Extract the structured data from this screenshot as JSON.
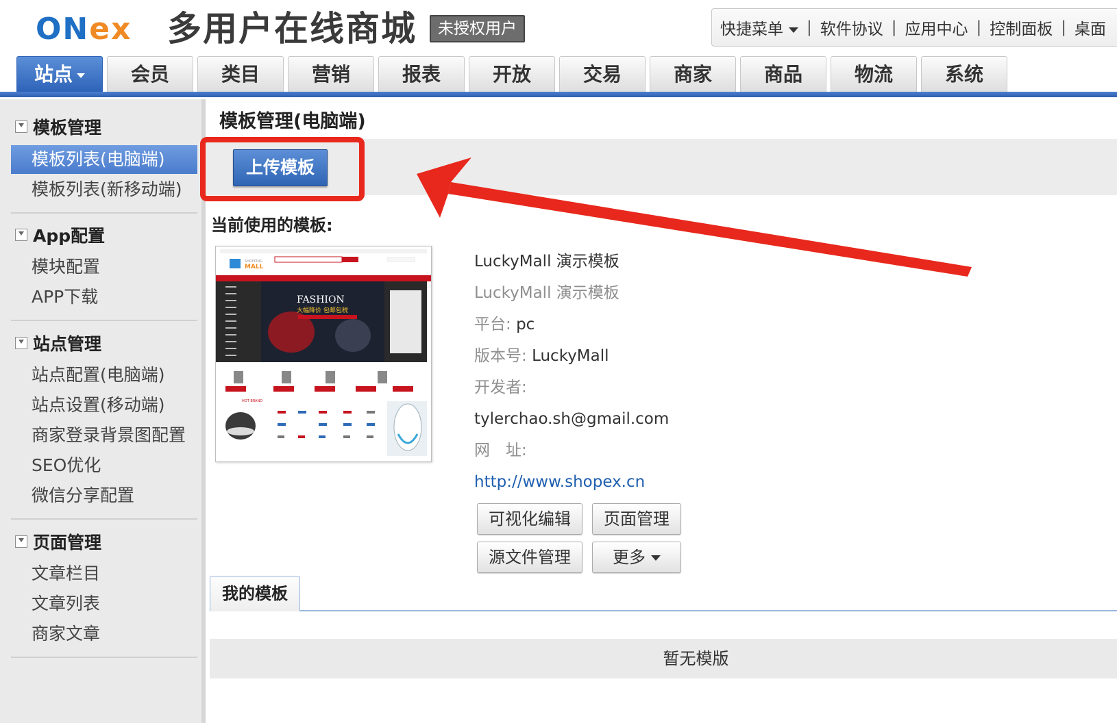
{
  "header": {
    "logo_text": "ONex",
    "site_title": "多用户在线商城",
    "license_badge": "未授权用户",
    "quick_menu": {
      "items": [
        "快捷菜单",
        "软件协议",
        "应用中心",
        "控制面板",
        "桌面"
      ]
    }
  },
  "nav": {
    "tabs": [
      {
        "label": "站点",
        "active": true
      },
      {
        "label": "会员"
      },
      {
        "label": "类目"
      },
      {
        "label": "营销"
      },
      {
        "label": "报表"
      },
      {
        "label": "开放"
      },
      {
        "label": "交易"
      },
      {
        "label": "商家"
      },
      {
        "label": "商品"
      },
      {
        "label": "物流"
      },
      {
        "label": "系统"
      }
    ]
  },
  "sidebar": {
    "groups": [
      {
        "title": "模板管理",
        "items": [
          {
            "label": "模板列表(电脑端)",
            "active": true
          },
          {
            "label": "模板列表(新移动端)"
          }
        ]
      },
      {
        "title": "App配置",
        "items": [
          {
            "label": "模块配置"
          },
          {
            "label": "APP下载"
          }
        ]
      },
      {
        "title": "站点管理",
        "items": [
          {
            "label": "站点配置(电脑端)"
          },
          {
            "label": "站点设置(移动端)"
          },
          {
            "label": "商家登录背景图配置"
          },
          {
            "label": "SEO优化"
          },
          {
            "label": "微信分享配置"
          }
        ]
      },
      {
        "title": "页面管理",
        "items": [
          {
            "label": "文章栏目"
          },
          {
            "label": "文章列表"
          },
          {
            "label": "商家文章"
          }
        ]
      }
    ]
  },
  "main": {
    "page_title": "模板管理(电脑端)",
    "upload_button": "上传模板",
    "current_label": "当前使用的模板:",
    "template": {
      "name": "LuckyMall 演示模板",
      "description": "LuckyMall 演示模板",
      "platform_label": "平台:",
      "platform_value": "pc",
      "version_label": "版本号:",
      "version_value": "LuckyMall",
      "developer_label": "开发者:",
      "developer_value": "tylerchao.sh@gmail.com",
      "website_label": "网　址:",
      "website_value": "http://www.shopex.cn"
    },
    "actions": {
      "visual_edit": "可视化编辑",
      "page_manage": "页面管理",
      "source_manage": "源文件管理",
      "more": "更多"
    },
    "my_templates_tab": "我的模板",
    "empty_text": "暂无模版"
  },
  "thumbnail": {
    "brand_top": "SHOPPING",
    "brand_main": "MALL",
    "banner_title": "FASHION",
    "banner_sub": "大幅降价 包邮包税",
    "section_label": "HOT BRAND"
  },
  "colors": {
    "accent_blue": "#2e63b8",
    "highlight_red": "#e8281c",
    "link_blue": "#1f5fb0",
    "logo_blue": "#1f6fc5",
    "logo_orange": "#f08a24"
  }
}
